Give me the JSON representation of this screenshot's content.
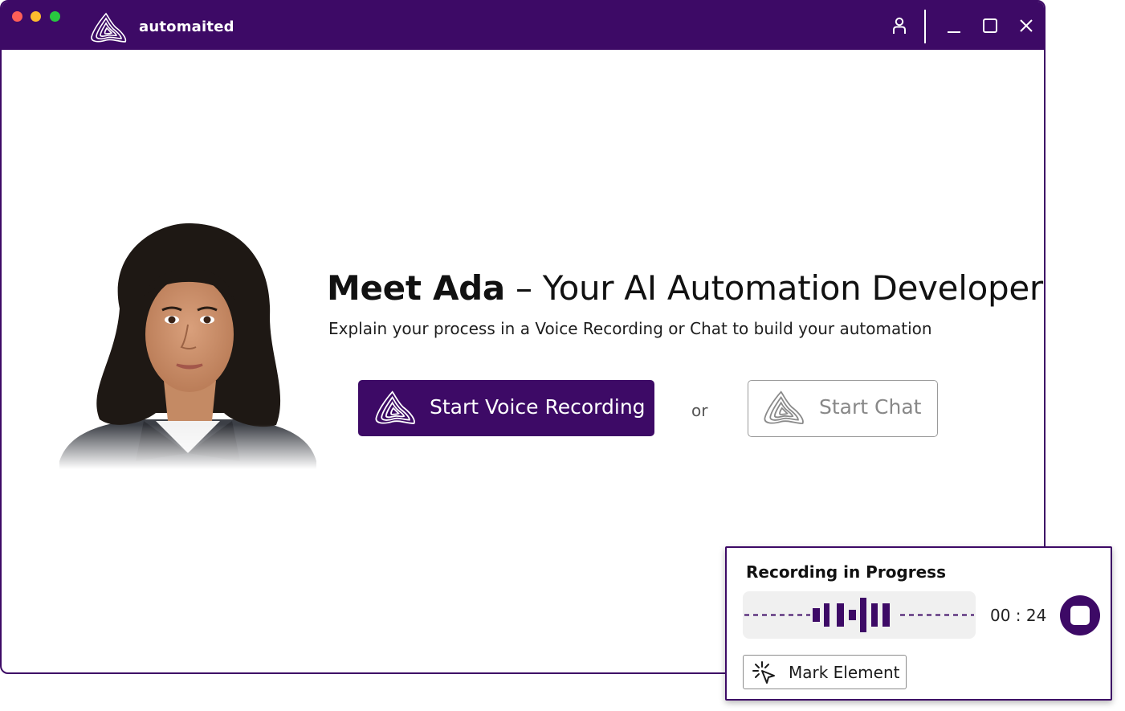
{
  "app": {
    "name": "automaited"
  },
  "titlebar": {
    "icons": [
      "user-icon",
      "minimize-icon",
      "maximize-icon",
      "close-icon"
    ]
  },
  "hero": {
    "title_strong": "Meet Ada",
    "title_rest": " – Your AI Automation Developer",
    "subtitle": "Explain your process in a Voice Recording or Chat to build your automation",
    "primary_button": "Start Voice Recording",
    "separator": "or",
    "secondary_button": "Start Chat"
  },
  "recording": {
    "title": "Recording in Progress",
    "timer": "00 : 24",
    "mark_button": "Mark Element",
    "icons": [
      "waveform-icon",
      "stop-icon",
      "mark-element-icon"
    ]
  },
  "colors": {
    "brand": "#3d0a66",
    "traffic_red": "#ff5f57",
    "traffic_yellow": "#febc2e",
    "traffic_green": "#28c840",
    "wave_bg": "#f0f0f0"
  }
}
